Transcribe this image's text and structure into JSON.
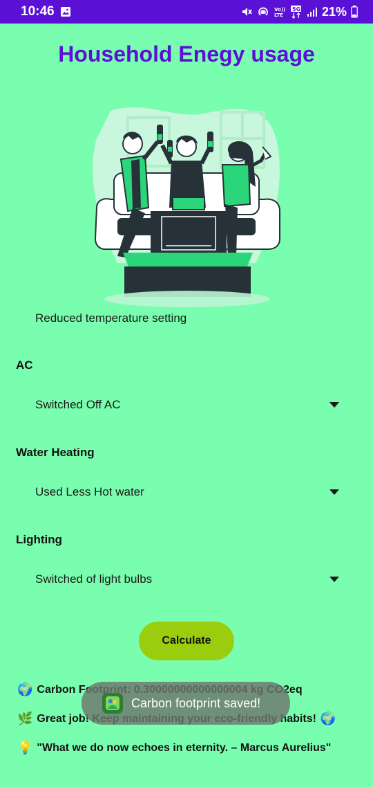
{
  "status_bar": {
    "time": "10:46",
    "battery_percent": "21%",
    "icons": [
      "gallery-icon",
      "mute-icon",
      "hotspot-icon",
      "volte-icon",
      "5g-icon",
      "signal-icon",
      "battery-icon"
    ]
  },
  "app": {
    "title": "Household Enegy usage",
    "clipped_text": "Reduced temperature setting"
  },
  "sections": [
    {
      "label": "AC",
      "selected": "Switched Off AC"
    },
    {
      "label": "Water Heating",
      "selected": "Used Less Hot water"
    },
    {
      "label": "Lighting",
      "selected": "Switched of light bulbs"
    }
  ],
  "calculate_label": "Calculate",
  "results": {
    "footprint": "Carbon Footprint: 0.30000000000000004 kg CO2eq",
    "footprint_emoji": "🌍",
    "message": "Great job! Keep maintaining your eco-friendly habits! ",
    "message_emoji": "🌿",
    "message_end_emoji": "🌍",
    "quote": "\"What we do now echoes in eternity. – Marcus Aurelius\"",
    "quote_emoji": "💡"
  },
  "toast": {
    "text": "Carbon footprint saved!"
  },
  "colors": {
    "background": "#79FDAE",
    "status_bar": "#5B10D6",
    "title": "#5B10D6",
    "button": "#9ACD0E",
    "illustration_accent": "#2BD67B",
    "illustration_dark": "#263238"
  }
}
